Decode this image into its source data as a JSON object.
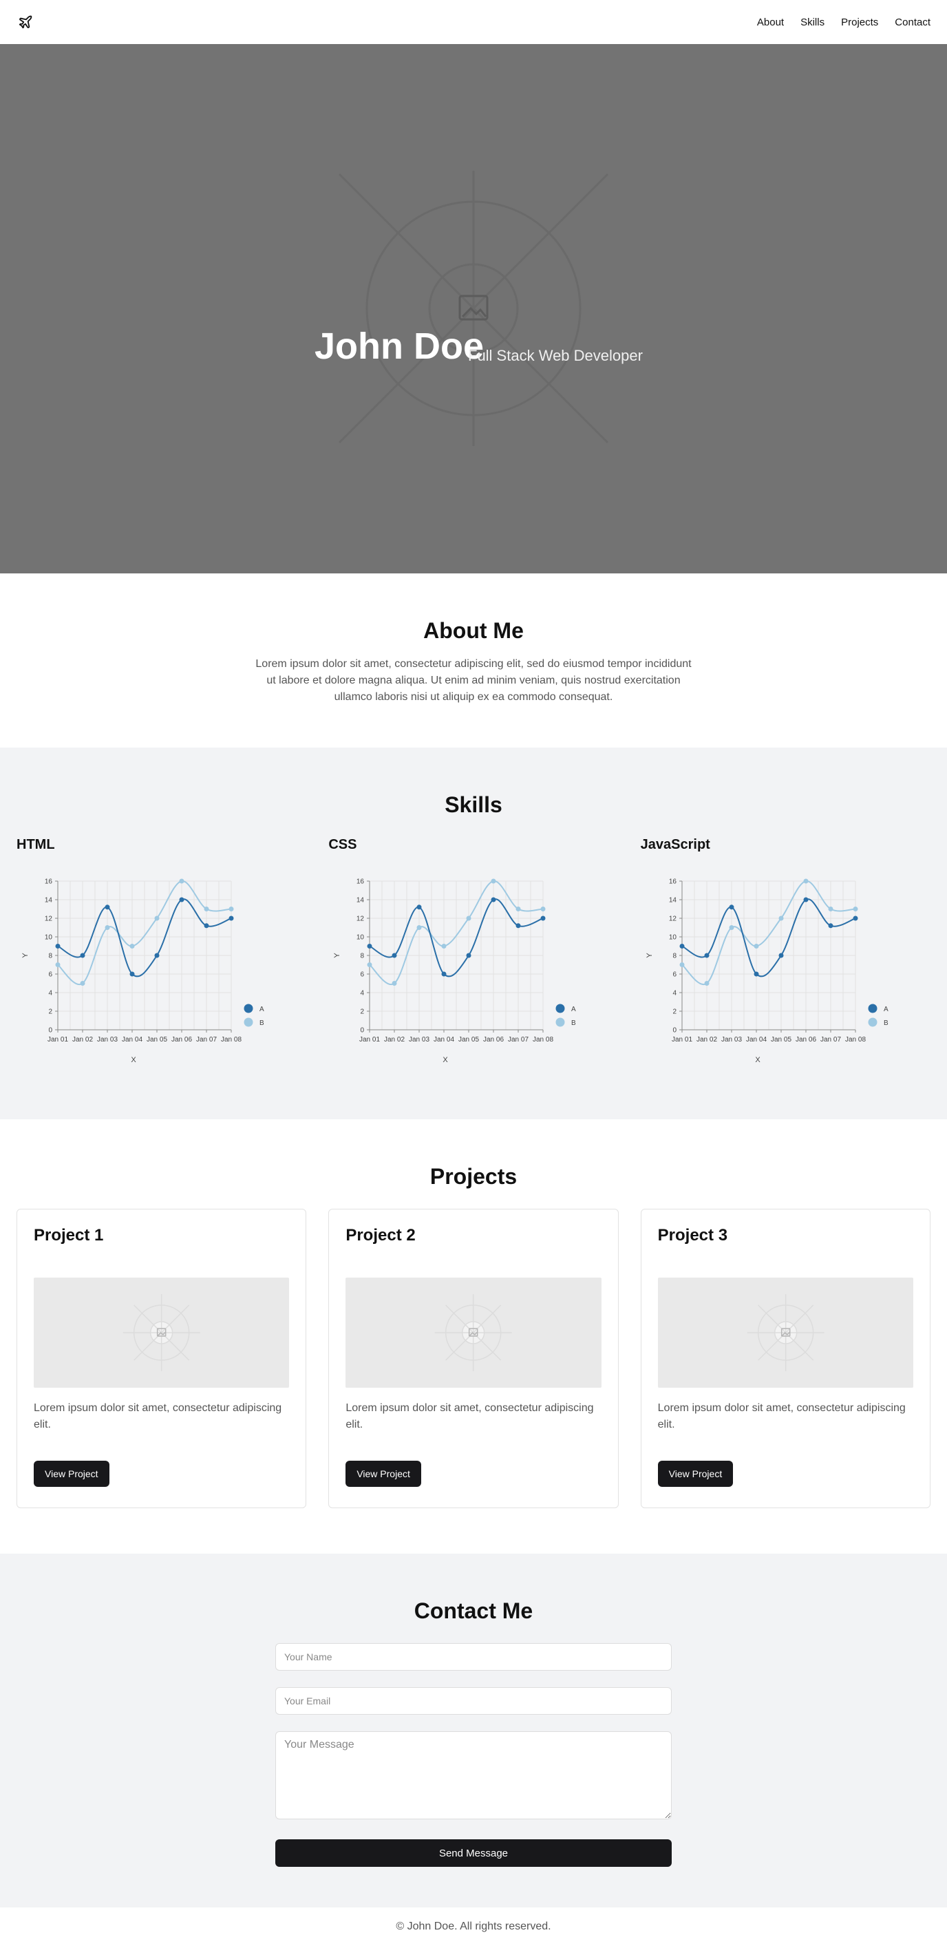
{
  "nav": {
    "logo_icon": "plane-icon",
    "links": [
      "About",
      "Skills",
      "Projects",
      "Contact"
    ]
  },
  "hero": {
    "title": "John Doe",
    "subtitle": "Full Stack Web Developer",
    "image_icon": "image-placeholder-icon"
  },
  "about": {
    "title": "About Me",
    "text": "Lorem ipsum dolor sit amet, consectetur adipiscing elit, sed do eiusmod tempor incididunt ut labore et dolore magna aliqua. Ut enim ad minim veniam, quis nostrud exercitation ullamco laboris nisi ut aliquip ex ea commodo consequat."
  },
  "skills": {
    "title": "Skills",
    "items": [
      {
        "name": "HTML"
      },
      {
        "name": "CSS"
      },
      {
        "name": "JavaScript"
      }
    ]
  },
  "chart_data": [
    {
      "type": "line",
      "x": [
        "Jan 01",
        "Jan 02",
        "Jan 03",
        "Jan 04",
        "Jan 05",
        "Jan 06",
        "Jan 07",
        "Jan 08"
      ],
      "series": [
        {
          "name": "A",
          "values": [
            9,
            8,
            13.2,
            6,
            8,
            14,
            11.2,
            12
          ]
        },
        {
          "name": "B",
          "values": [
            7,
            5,
            11,
            9,
            12,
            16,
            13,
            13
          ]
        }
      ],
      "xlabel": "X",
      "ylabel": "Y",
      "ylim": [
        0,
        16
      ],
      "yticks": [
        0,
        2,
        4,
        6,
        8,
        10,
        12,
        14,
        16
      ],
      "grid": true,
      "legend": "right",
      "colors": {
        "A": "#2a6fa8",
        "B": "#9ec9e2"
      }
    },
    {
      "type": "line",
      "x": [
        "Jan 01",
        "Jan 02",
        "Jan 03",
        "Jan 04",
        "Jan 05",
        "Jan 06",
        "Jan 07",
        "Jan 08"
      ],
      "series": [
        {
          "name": "A",
          "values": [
            9,
            8,
            13.2,
            6,
            8,
            14,
            11.2,
            12
          ]
        },
        {
          "name": "B",
          "values": [
            7,
            5,
            11,
            9,
            12,
            16,
            13,
            13
          ]
        }
      ],
      "xlabel": "X",
      "ylabel": "Y",
      "ylim": [
        0,
        16
      ],
      "yticks": [
        0,
        2,
        4,
        6,
        8,
        10,
        12,
        14,
        16
      ],
      "grid": true,
      "legend": "right",
      "colors": {
        "A": "#2a6fa8",
        "B": "#9ec9e2"
      }
    },
    {
      "type": "line",
      "x": [
        "Jan 01",
        "Jan 02",
        "Jan 03",
        "Jan 04",
        "Jan 05",
        "Jan 06",
        "Jan 07",
        "Jan 08"
      ],
      "series": [
        {
          "name": "A",
          "values": [
            9,
            8,
            13.2,
            6,
            8,
            14,
            11.2,
            12
          ]
        },
        {
          "name": "B",
          "values": [
            7,
            5,
            11,
            9,
            12,
            16,
            13,
            13
          ]
        }
      ],
      "xlabel": "X",
      "ylabel": "Y",
      "ylim": [
        0,
        16
      ],
      "yticks": [
        0,
        2,
        4,
        6,
        8,
        10,
        12,
        14,
        16
      ],
      "grid": true,
      "legend": "right",
      "colors": {
        "A": "#2a6fa8",
        "B": "#9ec9e2"
      }
    }
  ],
  "projects": {
    "title": "Projects",
    "items": [
      {
        "title": "Project 1",
        "desc": "Lorem ipsum dolor sit amet, consectetur adipiscing elit.",
        "button": "View Project"
      },
      {
        "title": "Project 2",
        "desc": "Lorem ipsum dolor sit amet, consectetur adipiscing elit.",
        "button": "View Project"
      },
      {
        "title": "Project 3",
        "desc": "Lorem ipsum dolor sit amet, consectetur adipiscing elit.",
        "button": "View Project"
      }
    ]
  },
  "contact": {
    "title": "Contact Me",
    "name_placeholder": "Your Name",
    "email_placeholder": "Your Email",
    "message_placeholder": "Your Message",
    "send_label": "Send Message"
  },
  "footer": {
    "text": "© John Doe. All rights reserved."
  }
}
